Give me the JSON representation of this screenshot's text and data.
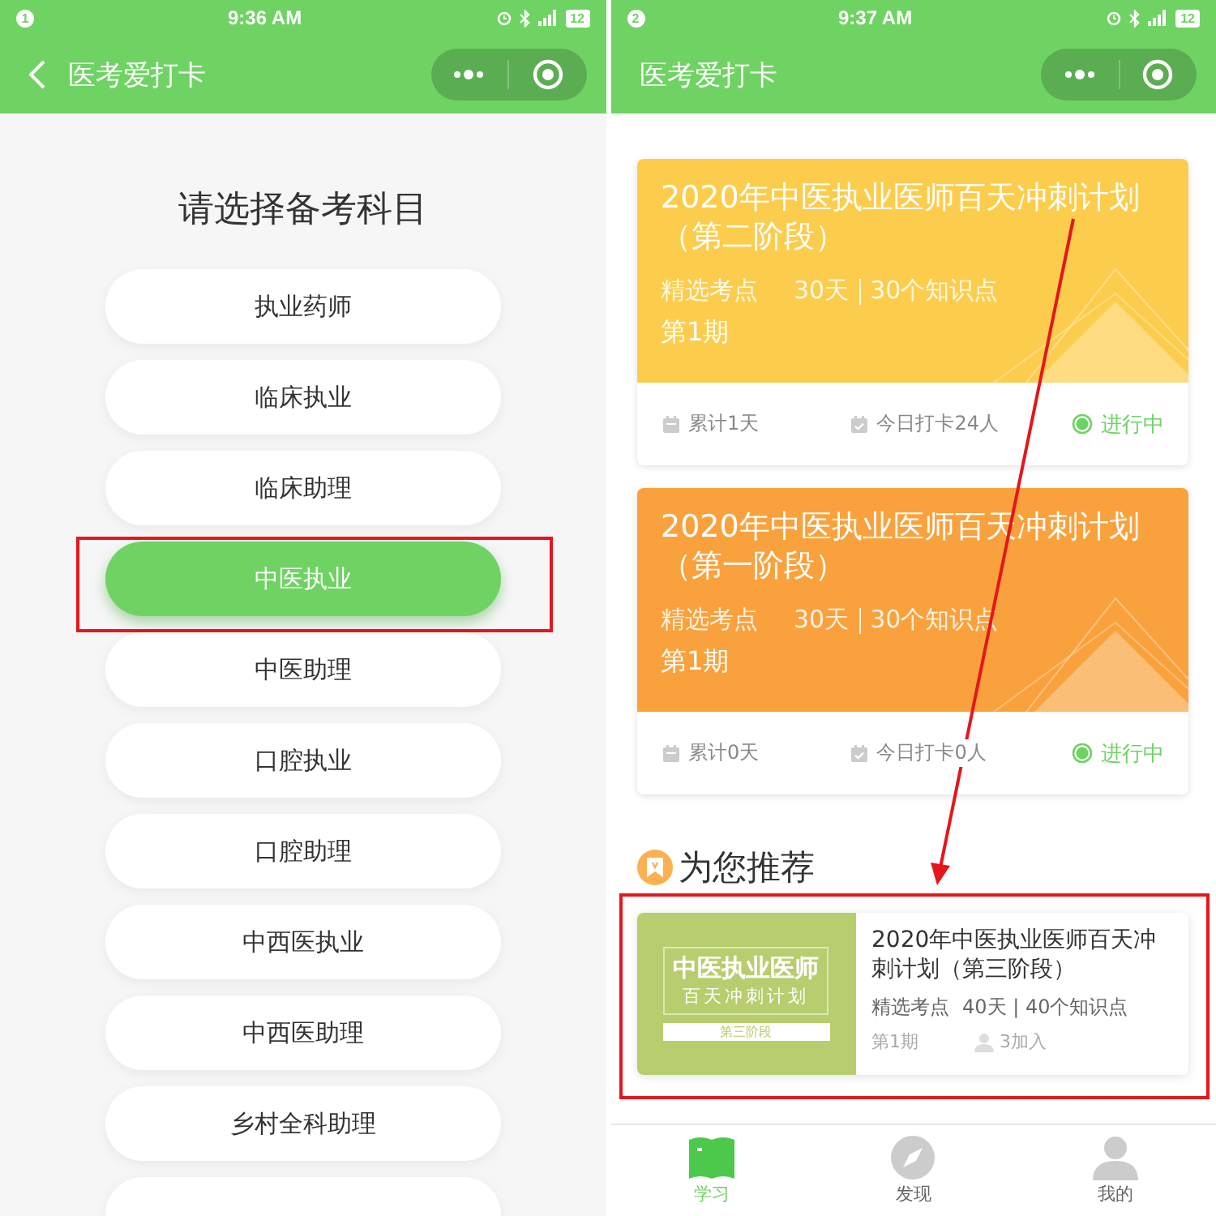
{
  "annotation_arrow": true,
  "screens": [
    {
      "kind": "subjects",
      "status_bar": {
        "notification": "1",
        "time": "9:36 AM",
        "battery": "12"
      },
      "header": {
        "title": "医考爱打卡",
        "back": true
      },
      "heading": "请选择备考科目",
      "more_below": true,
      "subjects": [
        {
          "label": "执业药师",
          "selected": false,
          "highlighted": false
        },
        {
          "label": "临床执业",
          "selected": false,
          "highlighted": false
        },
        {
          "label": "临床助理",
          "selected": false,
          "highlighted": false
        },
        {
          "label": "中医执业",
          "selected": true,
          "highlighted": true
        },
        {
          "label": "中医助理",
          "selected": false,
          "highlighted": false
        },
        {
          "label": "口腔执业",
          "selected": false,
          "highlighted": false
        },
        {
          "label": "口腔助理",
          "selected": false,
          "highlighted": false
        },
        {
          "label": "中西医执业",
          "selected": false,
          "highlighted": false
        },
        {
          "label": "中西医助理",
          "selected": false,
          "highlighted": false
        },
        {
          "label": "乡村全科助理",
          "selected": false,
          "highlighted": false
        }
      ]
    },
    {
      "kind": "plans",
      "status_bar": {
        "notification": "2",
        "time": "9:37 AM",
        "battery": "12"
      },
      "header": {
        "title": "医考爱打卡",
        "back": false
      },
      "plans": [
        {
          "title": "2020年中医执业医师百天冲刺计划（第二阶段）",
          "tag": "精选考点",
          "days": "30天",
          "points": "30个知识点",
          "period": "第1期",
          "total": "累计1天",
          "today": "今日打卡24人",
          "status": "进行中",
          "color": "#fccd4d"
        },
        {
          "title": "2020年中医执业医师百天冲刺计划（第一阶段）",
          "tag": "精选考点",
          "days": "30天",
          "points": "30个知识点",
          "period": "第1期",
          "total": "累计0天",
          "today": "今日打卡0人",
          "status": "进行中",
          "color": "#f9a23d"
        }
      ],
      "recommend": {
        "heading": "为您推荐",
        "card": {
          "cover": {
            "title": "中医执业医师",
            "subtitle": "百天冲刺计划",
            "stage": "第三阶段"
          },
          "title": "2020年中医执业医师百天冲刺计划（第三阶段）",
          "tag": "精选考点",
          "stats": "40天 | 40个知识点",
          "period": "第1期",
          "joined": "3加入",
          "highlighted": true
        }
      },
      "tabbar": [
        {
          "label": "学习",
          "selected": true
        },
        {
          "label": "发现",
          "selected": false
        },
        {
          "label": "我的",
          "selected": false
        }
      ]
    }
  ]
}
